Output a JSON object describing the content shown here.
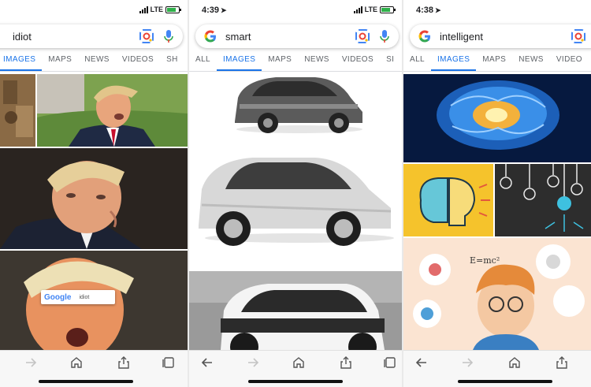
{
  "colors": {
    "accent": "#1a73e8",
    "tab_inactive": "#5f6368",
    "battery": "#2fb14a"
  },
  "screens": [
    {
      "status": {
        "time": "",
        "network": "LTE"
      },
      "search": {
        "query": "idiot"
      },
      "tabs": [
        "IMAGES",
        "MAPS",
        "NEWS",
        "VIDEOS",
        "SH"
      ],
      "active_tab": "IMAGES",
      "overlay_search": {
        "brand": "Google",
        "query": "idiot"
      }
    },
    {
      "status": {
        "time": "4:39",
        "network": "LTE"
      },
      "search": {
        "query": "smart"
      },
      "tabs": [
        "ALL",
        "IMAGES",
        "MAPS",
        "NEWS",
        "VIDEOS",
        "SI"
      ],
      "active_tab": "IMAGES"
    },
    {
      "status": {
        "time": "4:38",
        "network": ""
      },
      "search": {
        "query": "intelligent"
      },
      "tabs": [
        "ALL",
        "IMAGES",
        "MAPS",
        "NEWS",
        "VIDEO"
      ],
      "active_tab": "IMAGES",
      "illustration_text": "E=mc²"
    }
  ]
}
